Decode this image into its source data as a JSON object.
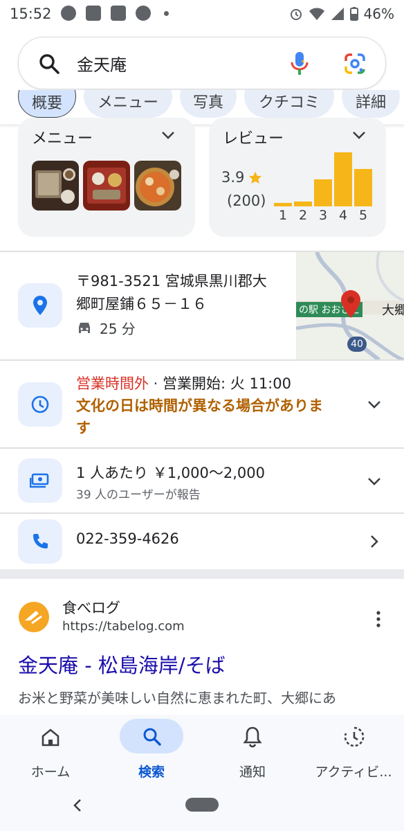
{
  "status_bar": {
    "time": "15:52",
    "battery": "46%"
  },
  "search": {
    "query": "金天庵"
  },
  "chips": [
    "概要",
    "メニュー",
    "写真",
    "クチコミ",
    "詳細"
  ],
  "menu_card": {
    "title": "メニュー"
  },
  "review_card": {
    "title": "レビュー",
    "rating": "3.9",
    "count": "(200)",
    "histogram": {
      "labels": [
        "1",
        "2",
        "3",
        "4",
        "5"
      ],
      "values": [
        0.07,
        0.09,
        0.5,
        1.0,
        0.69
      ]
    }
  },
  "address": {
    "text_line1": "〒981-3521 宮城県黒川郡大",
    "text_line2": "郷町屋鋪６５－１６",
    "drive_time": "25 分"
  },
  "map": {
    "label_station": "の駅 おおさと",
    "label_town": "大郷",
    "route": "40"
  },
  "hours": {
    "closed": "営業時間外",
    "separator": " · ",
    "opens": "営業開始: 火 11:00",
    "notice_line1": "文化の日は時間が異なる場合がありま",
    "notice_line2": "す"
  },
  "price": {
    "text": "1 人あたり ￥1,000～2,000",
    "sub": "39 人のユーザーが報告"
  },
  "phone": {
    "number": "022-359-4626"
  },
  "result": {
    "site_name": "食べログ",
    "url": "https://tabelog.com",
    "title": "金天庵 - 松島海岸/そば",
    "snippet": "お米と野菜が美味しい自然に恵まれた町、大郷にあ"
  },
  "bottom_nav": [
    {
      "label": "ホーム",
      "icon": "home-icon"
    },
    {
      "label": "検索",
      "icon": "search-icon"
    },
    {
      "label": "通知",
      "icon": "bell-icon"
    },
    {
      "label": "アクティビ...",
      "icon": "activity-icon"
    }
  ],
  "colors": {
    "accent": "#1a73e8",
    "star": "#f6b619",
    "closed": "#d93025",
    "notice": "#b06000",
    "link": "#1a0dab"
  }
}
